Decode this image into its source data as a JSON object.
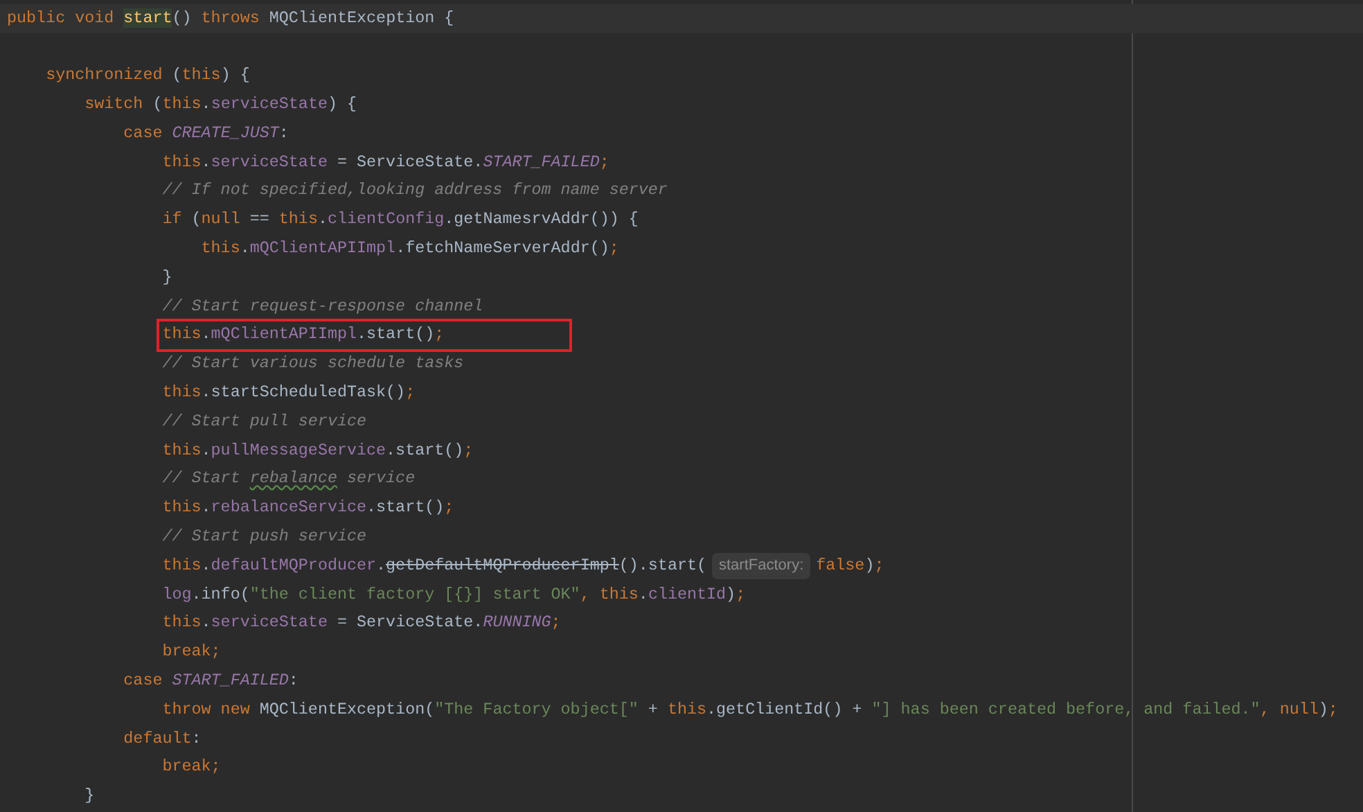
{
  "editor": {
    "lines": [
      {
        "kind": "code",
        "current": true,
        "boxed": false,
        "tokens": [
          {
            "kind": "kw",
            "text": "public void "
          },
          {
            "kind": "decl",
            "text": "start"
          },
          {
            "kind": "plain",
            "text": "() "
          },
          {
            "kind": "kw",
            "text": "throws "
          },
          {
            "kind": "plain",
            "text": "MQClientException {"
          }
        ]
      },
      {
        "kind": "blank"
      },
      {
        "kind": "code",
        "current": false,
        "boxed": false,
        "tokens": [
          {
            "kind": "kw",
            "text": "    synchronized "
          },
          {
            "kind": "plain",
            "text": "("
          },
          {
            "kind": "kw",
            "text": "this"
          },
          {
            "kind": "plain",
            "text": ") {"
          }
        ]
      },
      {
        "kind": "code",
        "current": false,
        "boxed": false,
        "tokens": [
          {
            "kind": "kw",
            "text": "        switch "
          },
          {
            "kind": "plain",
            "text": "("
          },
          {
            "kind": "kw",
            "text": "this"
          },
          {
            "kind": "plain",
            "text": "."
          },
          {
            "kind": "field",
            "text": "serviceState"
          },
          {
            "kind": "plain",
            "text": ") {"
          }
        ]
      },
      {
        "kind": "code",
        "current": false,
        "boxed": false,
        "tokens": [
          {
            "kind": "kw",
            "text": "            case "
          },
          {
            "kind": "const",
            "text": "CREATE_JUST"
          },
          {
            "kind": "plain",
            "text": ":"
          }
        ]
      },
      {
        "kind": "code",
        "current": false,
        "boxed": false,
        "tokens": [
          {
            "kind": "kw",
            "text": "                this"
          },
          {
            "kind": "plain",
            "text": "."
          },
          {
            "kind": "field",
            "text": "serviceState"
          },
          {
            "kind": "plain",
            "text": " = ServiceState."
          },
          {
            "kind": "const",
            "text": "START_FAILED"
          },
          {
            "kind": "kw",
            "text": ";"
          }
        ]
      },
      {
        "kind": "code",
        "current": false,
        "boxed": false,
        "tokens": [
          {
            "kind": "comment",
            "text": "                // If not specified,looking address from name server"
          }
        ]
      },
      {
        "kind": "code",
        "current": false,
        "boxed": false,
        "tokens": [
          {
            "kind": "kw",
            "text": "                if "
          },
          {
            "kind": "plain",
            "text": "("
          },
          {
            "kind": "kw",
            "text": "null "
          },
          {
            "kind": "plain",
            "text": "== "
          },
          {
            "kind": "kw",
            "text": "this"
          },
          {
            "kind": "plain",
            "text": "."
          },
          {
            "kind": "field",
            "text": "clientConfig"
          },
          {
            "kind": "plain",
            "text": ".getNamesrvAddr()) {"
          }
        ]
      },
      {
        "kind": "code",
        "current": false,
        "boxed": false,
        "tokens": [
          {
            "kind": "kw",
            "text": "                    this"
          },
          {
            "kind": "plain",
            "text": "."
          },
          {
            "kind": "field",
            "text": "mQClientAPIImpl"
          },
          {
            "kind": "plain",
            "text": ".fetchNameServerAddr()"
          },
          {
            "kind": "kw",
            "text": ";"
          }
        ]
      },
      {
        "kind": "code",
        "current": false,
        "boxed": false,
        "tokens": [
          {
            "kind": "plain",
            "text": "                }"
          }
        ]
      },
      {
        "kind": "code",
        "current": false,
        "boxed": false,
        "tokens": [
          {
            "kind": "comment",
            "text": "                // Start request-response channel"
          }
        ]
      },
      {
        "kind": "code",
        "current": false,
        "boxed": true,
        "tokens": [
          {
            "kind": "kw",
            "text": "                this"
          },
          {
            "kind": "plain",
            "text": "."
          },
          {
            "kind": "field",
            "text": "mQClientAPIImpl"
          },
          {
            "kind": "plain",
            "text": ".start()"
          },
          {
            "kind": "kw",
            "text": ";"
          }
        ]
      },
      {
        "kind": "code",
        "current": false,
        "boxed": false,
        "tokens": [
          {
            "kind": "comment",
            "text": "                // Start various schedule tasks"
          }
        ]
      },
      {
        "kind": "code",
        "current": false,
        "boxed": false,
        "tokens": [
          {
            "kind": "kw",
            "text": "                this"
          },
          {
            "kind": "plain",
            "text": ".startScheduledTask()"
          },
          {
            "kind": "kw",
            "text": ";"
          }
        ]
      },
      {
        "kind": "code",
        "current": false,
        "boxed": false,
        "tokens": [
          {
            "kind": "comment",
            "text": "                // Start pull service"
          }
        ]
      },
      {
        "kind": "code",
        "current": false,
        "boxed": false,
        "tokens": [
          {
            "kind": "kw",
            "text": "                this"
          },
          {
            "kind": "plain",
            "text": "."
          },
          {
            "kind": "field",
            "text": "pullMessageService"
          },
          {
            "kind": "plain",
            "text": ".start()"
          },
          {
            "kind": "kw",
            "text": ";"
          }
        ]
      },
      {
        "kind": "code",
        "current": false,
        "boxed": false,
        "tokens": [
          {
            "kind": "comment",
            "text": "                // Start "
          },
          {
            "kind": "typo",
            "text": "rebalance"
          },
          {
            "kind": "comment",
            "text": " service"
          }
        ]
      },
      {
        "kind": "code",
        "current": false,
        "boxed": false,
        "tokens": [
          {
            "kind": "kw",
            "text": "                this"
          },
          {
            "kind": "plain",
            "text": "."
          },
          {
            "kind": "field",
            "text": "rebalanceService"
          },
          {
            "kind": "plain",
            "text": ".start()"
          },
          {
            "kind": "kw",
            "text": ";"
          }
        ]
      },
      {
        "kind": "code",
        "current": false,
        "boxed": false,
        "tokens": [
          {
            "kind": "comment",
            "text": "                // Start push service"
          }
        ]
      },
      {
        "kind": "code",
        "current": false,
        "boxed": false,
        "tokens": [
          {
            "kind": "kw",
            "text": "                this"
          },
          {
            "kind": "plain",
            "text": "."
          },
          {
            "kind": "field",
            "text": "defaultMQProducer"
          },
          {
            "kind": "plain",
            "text": "."
          },
          {
            "kind": "deprecated",
            "text": "getDefaultMQProducerImpl"
          },
          {
            "kind": "plain",
            "text": "().start("
          },
          {
            "kind": "hint",
            "text": "startFactory:"
          },
          {
            "kind": "kw",
            "text": "false"
          },
          {
            "kind": "plain",
            "text": ")"
          },
          {
            "kind": "kw",
            "text": ";"
          }
        ]
      },
      {
        "kind": "code",
        "current": false,
        "boxed": false,
        "tokens": [
          {
            "kind": "field",
            "text": "                log"
          },
          {
            "kind": "plain",
            "text": ".info("
          },
          {
            "kind": "string",
            "text": "\"the client factory [{}] start OK\""
          },
          {
            "kind": "kw",
            "text": ", this"
          },
          {
            "kind": "plain",
            "text": "."
          },
          {
            "kind": "field",
            "text": "clientId"
          },
          {
            "kind": "plain",
            "text": ")"
          },
          {
            "kind": "kw",
            "text": ";"
          }
        ]
      },
      {
        "kind": "code",
        "current": false,
        "boxed": false,
        "tokens": [
          {
            "kind": "kw",
            "text": "                this"
          },
          {
            "kind": "plain",
            "text": "."
          },
          {
            "kind": "field",
            "text": "serviceState"
          },
          {
            "kind": "plain",
            "text": " = ServiceState."
          },
          {
            "kind": "const",
            "text": "RUNNING"
          },
          {
            "kind": "kw",
            "text": ";"
          }
        ]
      },
      {
        "kind": "code",
        "current": false,
        "boxed": false,
        "tokens": [
          {
            "kind": "kw",
            "text": "                break;"
          }
        ]
      },
      {
        "kind": "code",
        "current": false,
        "boxed": false,
        "tokens": [
          {
            "kind": "kw",
            "text": "            case "
          },
          {
            "kind": "const",
            "text": "START_FAILED"
          },
          {
            "kind": "plain",
            "text": ":"
          }
        ]
      },
      {
        "kind": "code",
        "current": false,
        "boxed": false,
        "tokens": [
          {
            "kind": "kw",
            "text": "                throw new "
          },
          {
            "kind": "plain",
            "text": "MQClientException("
          },
          {
            "kind": "string",
            "text": "\"The Factory object[\""
          },
          {
            "kind": "plain",
            "text": " + "
          },
          {
            "kind": "kw",
            "text": "this"
          },
          {
            "kind": "plain",
            "text": ".getClientId() + "
          },
          {
            "kind": "string",
            "text": "\"] has been created before, and failed.\""
          },
          {
            "kind": "kw",
            "text": ", null"
          },
          {
            "kind": "plain",
            "text": ")"
          },
          {
            "kind": "kw",
            "text": ";"
          }
        ]
      },
      {
        "kind": "code",
        "current": false,
        "boxed": false,
        "tokens": [
          {
            "kind": "kw",
            "text": "            default"
          },
          {
            "kind": "plain",
            "text": ":"
          }
        ]
      },
      {
        "kind": "code",
        "current": false,
        "boxed": false,
        "tokens": [
          {
            "kind": "kw",
            "text": "                break;"
          }
        ]
      },
      {
        "kind": "code",
        "current": false,
        "boxed": false,
        "tokens": [
          {
            "kind": "plain",
            "text": "        }"
          }
        ]
      }
    ]
  }
}
